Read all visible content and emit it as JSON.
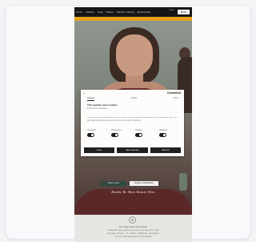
{
  "nav": {
    "items": [
      "Home",
      "Classes",
      "Yoga",
      "Pilates",
      "Teacher Training",
      "Membership"
    ],
    "util": "Log in",
    "book_label": "Book"
  },
  "banner": {
    "text": ""
  },
  "hero": {
    "cta_primary": "Book a class",
    "cta_secondary": "Explore membership",
    "tagline": "Breathe. Be. Move. Restore. Flow."
  },
  "cookie": {
    "close_label": "×",
    "brand": "Cookiebot",
    "tabs": [
      "Consent",
      "Details",
      "About"
    ],
    "title": "This website uses cookies",
    "subtitle": "Powered by Cookiebot",
    "note": "",
    "body": "We use cookies to personalise content and ads, to provide social media features and to analyse our traffic. We also share information about your use of our site with our partners.",
    "toggles": [
      {
        "label": "Necessary",
        "on": true
      },
      {
        "label": "Preferences",
        "on": true
      },
      {
        "label": "Statistics",
        "on": true
      },
      {
        "label": "Marketing",
        "on": true
      }
    ],
    "buttons": [
      "Deny",
      "Allow selection",
      "Allow all"
    ]
  },
  "footer": {
    "logo": "✿",
    "heading": "Your Yoga Studio Destination",
    "lines": [
      "Classes for every body, every level, every day of the week",
      "Hot yoga · Vinyasa · Yin · Pilates · Meditation · Breathwork",
      "Join our community and find your balance"
    ]
  },
  "colors": {
    "accent": "#e8a11b",
    "nav_bg": "#161616",
    "modal_btn": "#1f1f1f"
  }
}
